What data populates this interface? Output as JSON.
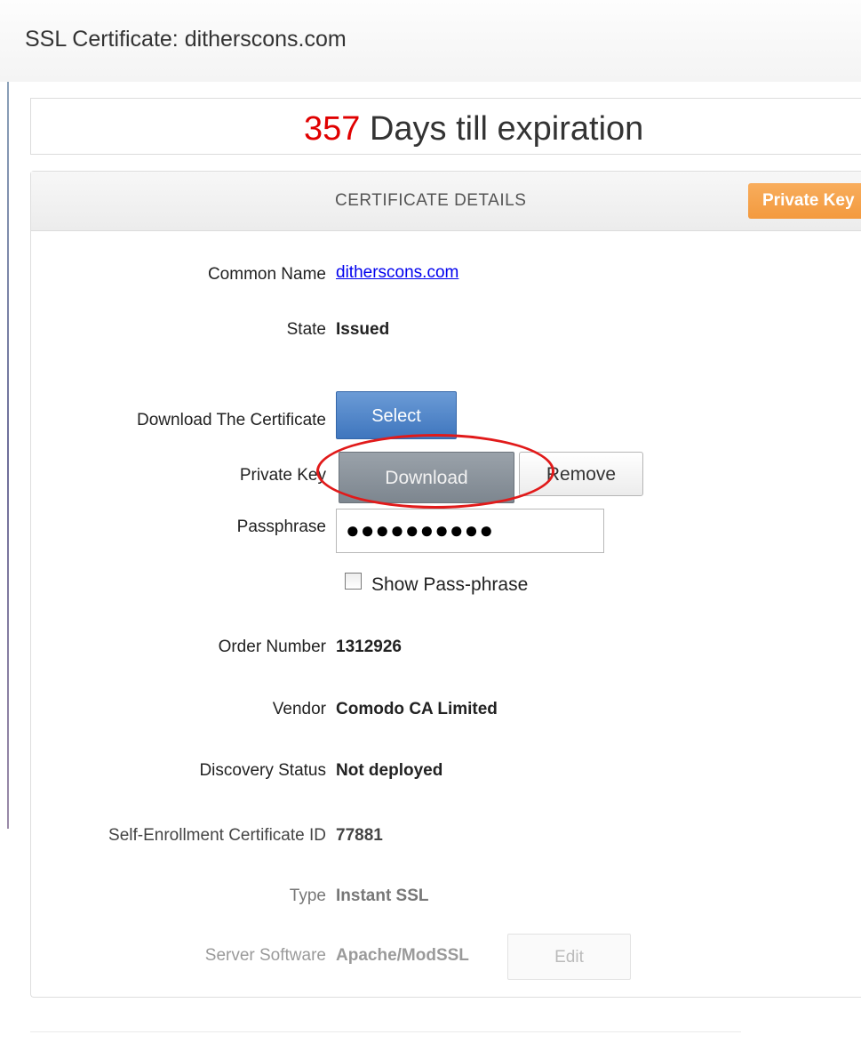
{
  "page": {
    "title": "SSL Certificate: ditherscons.com"
  },
  "expiry": {
    "days": "357",
    "suffix": " Days till expiration"
  },
  "panel": {
    "title": "CERTIFICATE DETAILS",
    "private_key_tab": "Private Key"
  },
  "fields": {
    "common_name": {
      "label": "Common Name",
      "value": "ditherscons.com"
    },
    "state": {
      "label": "State",
      "value": "Issued"
    },
    "download_certificate": {
      "label": "Download The Certificate",
      "button": "Select"
    },
    "private_key": {
      "label": "Private Key",
      "download_button": "Download",
      "remove_button": "Remove"
    },
    "passphrase": {
      "label": "Passphrase",
      "value": "●●●●●●●●●●"
    },
    "show_passphrase": {
      "label": "Show Pass-phrase",
      "checked": false
    },
    "order_number": {
      "label": "Order Number",
      "value": "1312926"
    },
    "vendor": {
      "label": "Vendor",
      "value": "Comodo CA Limited"
    },
    "discovery_status": {
      "label": "Discovery Status",
      "value": "Not deployed"
    },
    "self_enrollment_id": {
      "label": "Self-Enrollment Certificate ID",
      "value": "77881"
    },
    "type": {
      "label": "Type",
      "value": "Instant SSL"
    },
    "server_software": {
      "label": "Server Software",
      "value": "Apache/ModSSL",
      "button": "Edit"
    }
  },
  "colors": {
    "days_accent": "#e00000",
    "select_button": "#4f86c9",
    "download_button": "#8a939c",
    "private_key_tab": "#f5a24a",
    "highlight": "#e11a1a",
    "link": "#0000ee"
  }
}
